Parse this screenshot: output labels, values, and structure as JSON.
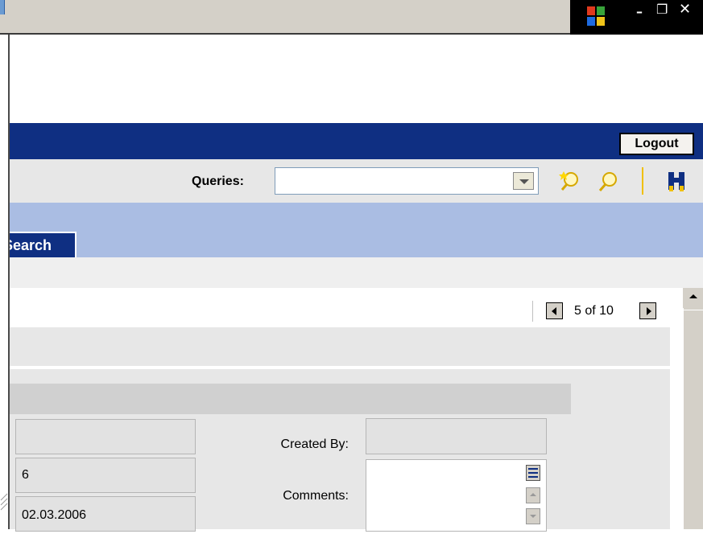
{
  "header": {
    "logout_label": "Logout"
  },
  "queries": {
    "label": "Queries:",
    "selected_value": ""
  },
  "tabs": [
    {
      "label": "Search",
      "visible_label": "Search"
    }
  ],
  "pager": {
    "text": "5 of 10"
  },
  "form": {
    "field_1_value": "",
    "field_2_value": "6",
    "field_3_value": "02.03.2006",
    "created_by_label": "Created By:",
    "created_by_value": "",
    "comments_label": "Comments:",
    "comments_value": ""
  },
  "colors": {
    "header_blue": "#0f2f82",
    "tab_row": "#aabde3",
    "query_bar": "#e7e7e7",
    "form_bg": "#e7e7e7",
    "field_bg": "#e2e2e2"
  },
  "icons": [
    "new-query-icon",
    "search-query-icon",
    "binoculars-icon",
    "windows-logo-icon"
  ]
}
